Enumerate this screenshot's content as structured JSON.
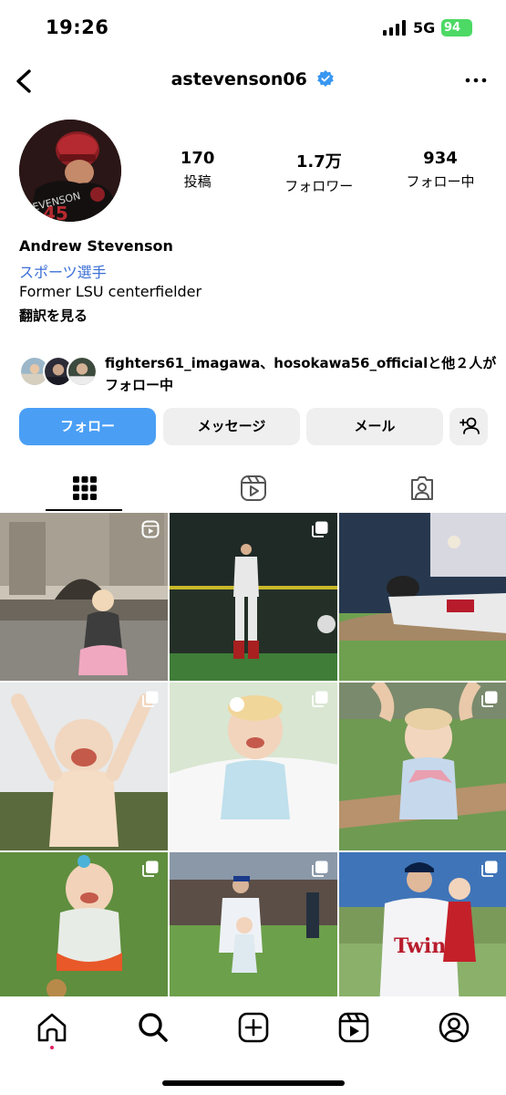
{
  "status_bar": {
    "time": "19:26",
    "network": "5G",
    "battery": "94"
  },
  "header": {
    "username": "astevenson06",
    "verified_color": "#3897f0"
  },
  "profile": {
    "stats": [
      {
        "value": "170",
        "label": "投稿"
      },
      {
        "value": "1.7万",
        "label": "フォロワー"
      },
      {
        "value": "934",
        "label": "フォロー中"
      }
    ],
    "name": "Andrew Stevenson",
    "category": "スポーツ選手",
    "bio": "Former LSU centerfielder",
    "translate_link": "翻訳を見る",
    "followed_by": "fighters61_imagawa、hosokawa56_officialと他２人がフォロー中"
  },
  "buttons": {
    "follow": "フォロー",
    "message": "メッセージ",
    "email": "メール"
  },
  "colors": {
    "accent": "#4a9ff5",
    "link": "#3b6fd6",
    "button_bg": "#efefef",
    "notification_dot": "#e0245e"
  },
  "tabs": [
    "grid-icon",
    "reels-icon",
    "tagged-icon"
  ],
  "posts": [
    {
      "icon": "reel-badge-icon"
    },
    {
      "icon": "multi-post-icon"
    },
    {
      "icon": "none"
    },
    {
      "icon": "multi-post-icon"
    },
    {
      "icon": "multi-post-icon"
    },
    {
      "icon": "multi-post-icon"
    },
    {
      "icon": "multi-post-icon"
    },
    {
      "icon": "multi-post-icon"
    },
    {
      "icon": "multi-post-icon"
    }
  ],
  "bottom_nav": [
    "home-icon",
    "search-icon",
    "create-icon",
    "reels-icon",
    "profile-icon"
  ]
}
